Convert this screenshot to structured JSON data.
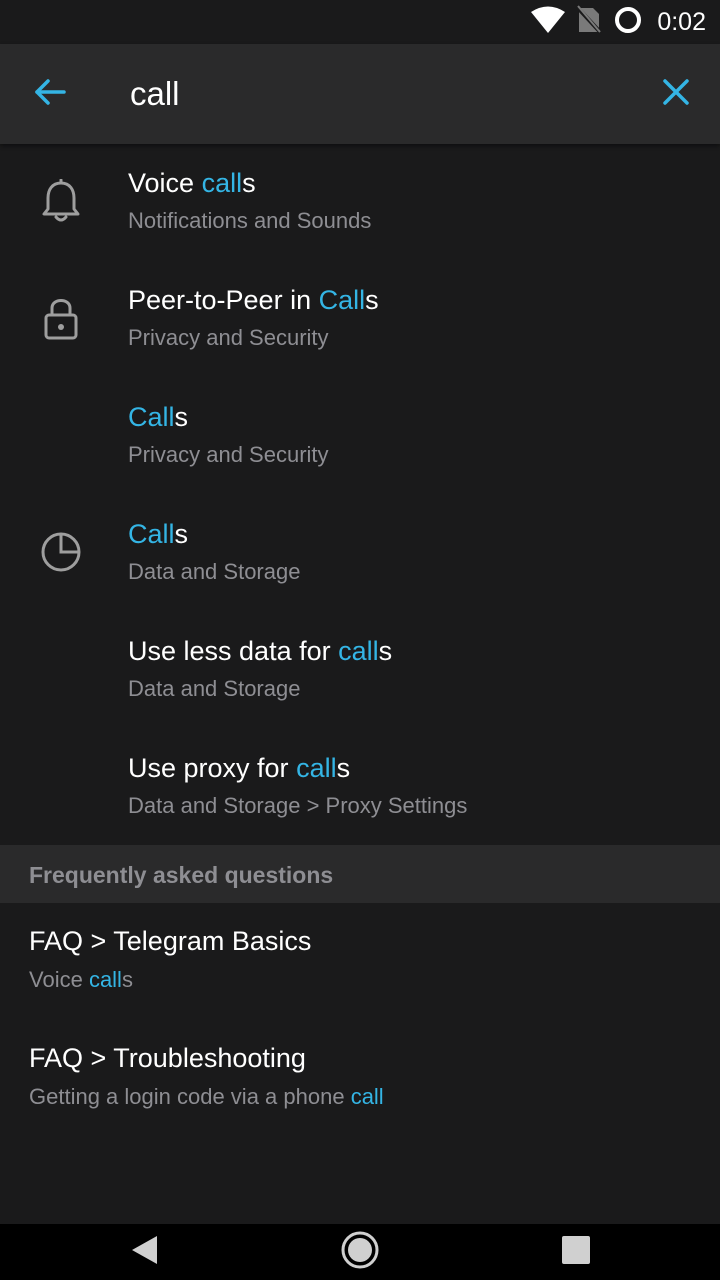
{
  "status_bar": {
    "time": "0:02",
    "icons": [
      "wifi-icon",
      "no-sim-icon",
      "sync-circle-icon"
    ]
  },
  "search": {
    "query": "call",
    "back_icon": "arrow-left-icon",
    "clear_icon": "close-icon"
  },
  "colors": {
    "accent": "#34b5e5",
    "background": "#1a1a1b",
    "app_bar": "#2a2a2b",
    "secondary_text": "#8e8e93"
  },
  "results": [
    {
      "title_pre": "Voice ",
      "title_hl": "call",
      "title_post": "s",
      "subtitle": "Notifications and Sounds",
      "icon": "bell-icon"
    },
    {
      "title_pre": "Peer-to-Peer in ",
      "title_hl": "Call",
      "title_post": "s",
      "subtitle": "Privacy and Security",
      "icon": "lock-icon"
    },
    {
      "title_pre": "",
      "title_hl": "Call",
      "title_post": "s",
      "subtitle": "Privacy and Security",
      "icon": ""
    },
    {
      "title_pre": "",
      "title_hl": "Call",
      "title_post": "s",
      "subtitle": "Data and Storage",
      "icon": "pie-chart-icon"
    },
    {
      "title_pre": "Use less data for ",
      "title_hl": "call",
      "title_post": "s",
      "subtitle": "Data and Storage",
      "icon": ""
    },
    {
      "title_pre": "Use proxy for ",
      "title_hl": "call",
      "title_post": "s",
      "subtitle": "Data and Storage > Proxy Settings",
      "icon": ""
    }
  ],
  "faq_section": {
    "header": "Frequently asked questions",
    "items": [
      {
        "title": "FAQ > Telegram Basics",
        "sub_pre": "Voice ",
        "sub_hl": "call",
        "sub_post": "s"
      },
      {
        "title": "FAQ > Troubleshooting",
        "sub_pre": "Getting a login code via a phone ",
        "sub_hl": "call",
        "sub_post": ""
      }
    ]
  },
  "nav_bar": {
    "buttons": [
      "back-triangle-icon",
      "home-circle-icon",
      "recents-square-icon"
    ]
  }
}
